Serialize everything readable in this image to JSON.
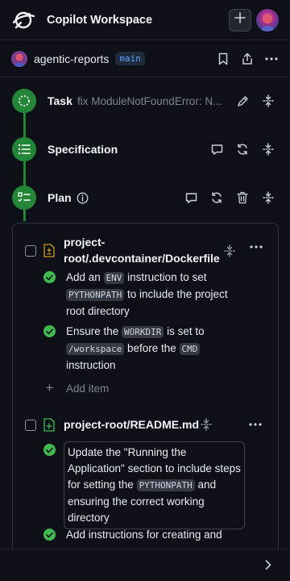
{
  "app": {
    "title": "Copilot Workspace"
  },
  "repo": {
    "name": "agentic-reports",
    "branch": "main"
  },
  "steps": {
    "task": {
      "title": "Task",
      "subtitle": "fix ModuleNotFoundError: N..."
    },
    "spec": {
      "title": "Specification"
    },
    "plan": {
      "title": "Plan"
    }
  },
  "plan": {
    "files": [
      {
        "path_line1": "project-",
        "path_line2": "root/.devcontainer/Dockerfile",
        "tasks": [
          {
            "t1": "Add an ",
            "c1": "ENV",
            "t2": " instruction to set ",
            "c2": "PYTHONPATH",
            "t3": " to include the project root directory"
          },
          {
            "t1": "Ensure the ",
            "c1": "WORKDIR",
            "t2": " is set to ",
            "c2": "/workspace",
            "t3": " before the ",
            "c3": "CMD",
            "t4": " instruction"
          }
        ],
        "add_item": "Add item"
      },
      {
        "path": "project-root/README.md",
        "tasks": [
          {
            "t1": "Update the \"Running the Application\" section to include steps for setting the ",
            "c1": "PYTHONPATH",
            "t2": " and ensuring the correct working directory"
          },
          {
            "t1": "Add instructions for creating and"
          }
        ]
      }
    ]
  },
  "colors": {
    "accent_green": "#238636",
    "check_green": "#3fb950",
    "branch_blue": "#58a6ff",
    "background": "#0d1117"
  },
  "icons": [
    "copilot-logo",
    "plus-icon",
    "bookmark-icon",
    "share-icon",
    "kebab-icon",
    "pencil-icon",
    "unfold-icon",
    "comment-icon",
    "sync-icon",
    "trash-icon",
    "info-icon",
    "file-diff-icon",
    "file-added-icon",
    "check-circle-icon",
    "chevron-right-icon"
  ]
}
